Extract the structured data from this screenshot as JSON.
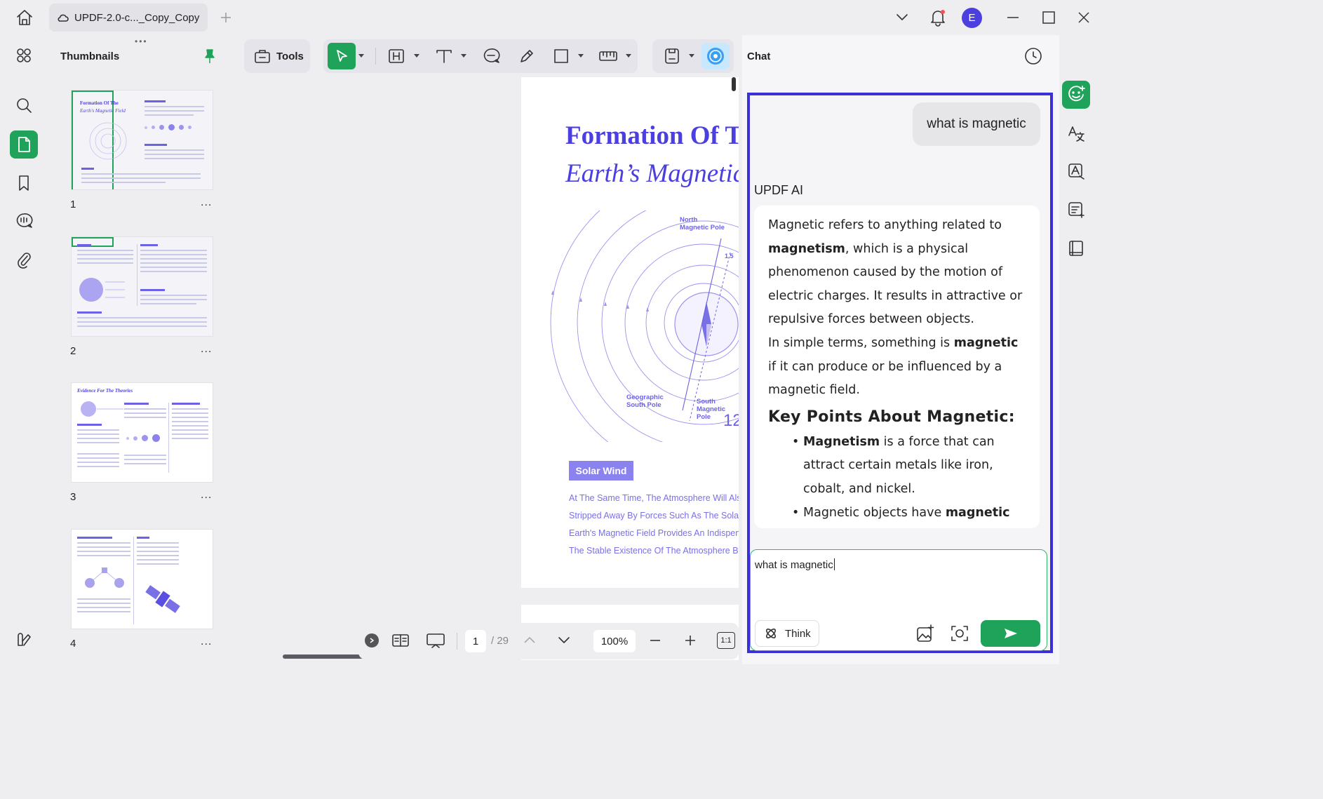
{
  "titlebar": {
    "tab_title": "UPDF-2.0-c..._Copy_Copy",
    "avatar_letter": "E"
  },
  "thumbnails": {
    "title": "Thumbnails",
    "pages": [
      {
        "number": "1",
        "more": "..."
      },
      {
        "number": "2",
        "more": "..."
      },
      {
        "number": "3",
        "more": "..."
      },
      {
        "number": "4",
        "more": "..."
      }
    ],
    "thumb1_title": "Formation Of The",
    "thumb1_subtitle": "Earth's Magnetic Field",
    "thumb3_title": "Evidence For The Theories"
  },
  "toolbar": {
    "tools_label": "Tools"
  },
  "document": {
    "title_line1": "Formation Of The",
    "title_line2": "Earth’s Magnetic Field",
    "label_north": "North\nMagnetic Pole",
    "label_geo": "Geographic\nSouth Pole",
    "label_south": "South\nMagnetic\nPole",
    "angle_label": "1.5",
    "number_label": "12",
    "solar_wind": "Solar Wind",
    "lines": [
      "At The Same Time, The Atmosphere Will Also",
      "Stripped Away By Forces Such As The Solar",
      "Earth's Magnetic Field Provides An Indispens",
      "The Stable Existence Of The Atmosphere By"
    ]
  },
  "navigation": {
    "current_page": "1",
    "total_pages": "/ 29",
    "zoom": "100%",
    "fit_label": "1:1"
  },
  "chat": {
    "title": "Chat",
    "user_message": "what is magnetic",
    "assistant_name": "UPDF AI",
    "response": {
      "p1_a": "Magnetic refers to anything related to ",
      "p1_b": "magnetism",
      "p1_c": ", which is a physical phenomenon caused by the motion of electric charges. It results in attractive or repulsive forces between objects.",
      "p2_a": "In simple terms, something is ",
      "p2_b": "magnetic",
      "p2_c": " if it can produce or be influenced by a magnetic field.",
      "heading": "Key Points About Magnetic:",
      "b1_a": "Magnetism",
      "b1_b": " is a force that can attract certain metals like iron, cobalt, and nickel.",
      "b2_a": "Magnetic objects have ",
      "b2_b": "magnetic"
    },
    "input_value": "what is magnetic",
    "think_label": "Think"
  },
  "colors": {
    "accent_green": "#1fa35b",
    "brand_purple": "#4c3fe0",
    "highlight_border": "#3b2fd6"
  }
}
